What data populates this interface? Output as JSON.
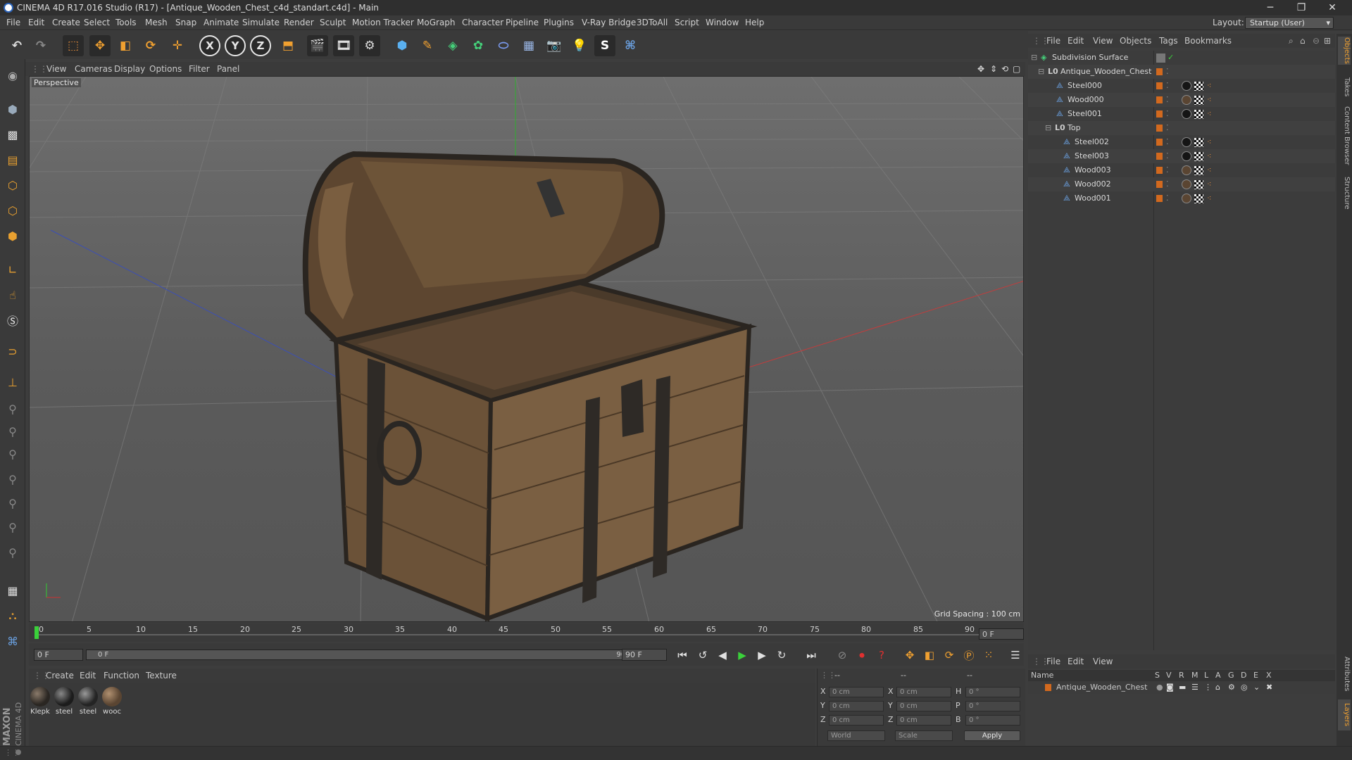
{
  "titlebar": {
    "title": "CINEMA 4D R17.016 Studio (R17) - [Antique_Wooden_Chest_c4d_standart.c4d] - Main",
    "minimize": "─",
    "restore": "❐",
    "close": "✕"
  },
  "menu": [
    "File",
    "Edit",
    "Create",
    "Select",
    "Tools",
    "Mesh",
    "Snap",
    "Animate",
    "Simulate",
    "Render",
    "Sculpt",
    "Motion Tracker",
    "MoGraph",
    "Character",
    "Pipeline",
    "Plugins",
    "V-Ray Bridge",
    "3DToAll",
    "Script",
    "Window",
    "Help"
  ],
  "layout": {
    "label": "Layout:",
    "value": "Startup (User)"
  },
  "toolbar": {
    "axis_x": "X",
    "axis_y": "Y",
    "axis_z": "Z"
  },
  "viewport": {
    "menu": [
      "View",
      "Cameras",
      "Display",
      "Options",
      "Filter",
      "Panel"
    ],
    "label": "Perspective",
    "grid_spacing": "Grid Spacing : 100 cm"
  },
  "timeline": {
    "ticks": [
      "0",
      "5",
      "10",
      "15",
      "20",
      "25",
      "30",
      "35",
      "40",
      "45",
      "50",
      "55",
      "60",
      "65",
      "70",
      "75",
      "80",
      "85",
      "90"
    ],
    "current_frame": "0 F",
    "start_field": "0 F",
    "range_start": "0 F",
    "range_end": "90 F",
    "end_field": "90 F"
  },
  "materials": {
    "menu": [
      "Create",
      "Edit",
      "Function",
      "Texture"
    ],
    "items": [
      {
        "label": "Klepk",
        "color": "#2a2622"
      },
      {
        "label": "steel",
        "color": "#1c1c1c"
      },
      {
        "label": "steel",
        "color": "#242424"
      },
      {
        "label": "wooc",
        "color": "#5a4532"
      }
    ]
  },
  "coords": {
    "header_1": "--",
    "header_2": "--",
    "header_3": "--",
    "x_label": "X",
    "y_label": "Y",
    "z_label": "Z",
    "x2_label": "X",
    "y2_label": "Y",
    "z2_label": "Z",
    "h_label": "H",
    "p_label": "P",
    "b_label": "B",
    "pos_x": "0 cm",
    "pos_y": "0 cm",
    "pos_z": "0 cm",
    "size_x": "0 cm",
    "size_y": "0 cm",
    "size_z": "0 cm",
    "rot_h": "0 °",
    "rot_p": "0 °",
    "rot_b": "0 °",
    "mode_world": "World",
    "mode_scale": "Scale",
    "apply": "Apply"
  },
  "objects": {
    "menu": [
      "File",
      "Edit",
      "View",
      "Objects",
      "Tags",
      "Bookmarks"
    ],
    "rows": [
      {
        "name": "Subdivision Surface",
        "indent": 0
      },
      {
        "name": "Antique_Wooden_Chest",
        "indent": 1
      },
      {
        "name": "Steel000",
        "indent": 2
      },
      {
        "name": "Wood000",
        "indent": 2
      },
      {
        "name": "Steel001",
        "indent": 2
      },
      {
        "name": "Top",
        "indent": 2
      },
      {
        "name": "Steel002",
        "indent": 3
      },
      {
        "name": "Steel003",
        "indent": 3
      },
      {
        "name": "Wood003",
        "indent": 3
      },
      {
        "name": "Wood002",
        "indent": 3
      },
      {
        "name": "Wood001",
        "indent": 3
      }
    ]
  },
  "layers": {
    "menu": [
      "File",
      "Edit",
      "View"
    ],
    "headers": [
      "Name",
      "S",
      "V",
      "R",
      "M",
      "L",
      "A",
      "G",
      "D",
      "E",
      "X"
    ],
    "row_name": "Antique_Wooden_Chest"
  },
  "right_tabs": [
    "Objects",
    "Takes",
    "Content Browser",
    "Structure",
    "Attributes",
    "Layers"
  ],
  "brand": {
    "maxon": "MAXON",
    "product": "CINEMA 4D"
  },
  "accent": "#d2691e"
}
